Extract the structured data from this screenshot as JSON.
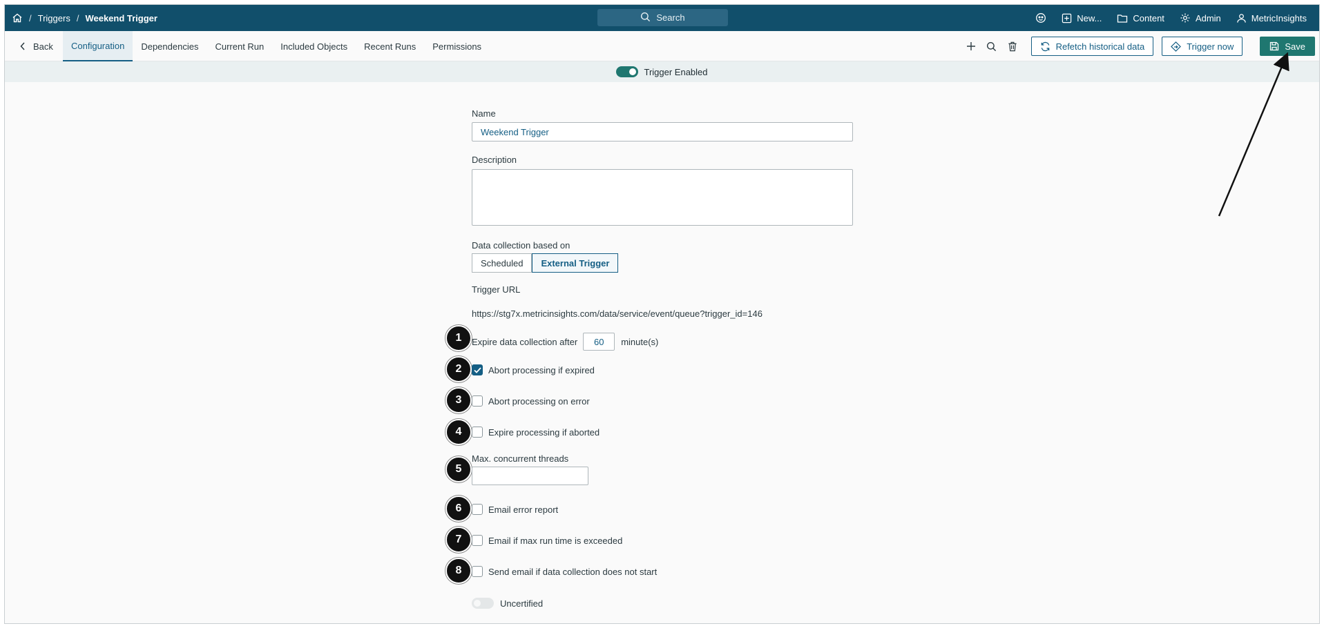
{
  "breadcrumb": {
    "home_icon": "home-icon",
    "separator": "/",
    "triggers": "Triggers",
    "current": "Weekend Trigger"
  },
  "search": {
    "label": "Search",
    "icon": "search-icon"
  },
  "topnav": {
    "new": "New...",
    "content": "Content",
    "admin": "Admin",
    "user": "MetricInsights"
  },
  "tabbar": {
    "back": "Back",
    "tabs": [
      "Configuration",
      "Dependencies",
      "Current Run",
      "Included Objects",
      "Recent Runs",
      "Permissions"
    ],
    "active_tab": "Configuration",
    "refetch": "Refetch historical data",
    "trigger_now": "Trigger now",
    "save": "Save"
  },
  "status": {
    "enabled": true,
    "label": "Trigger Enabled"
  },
  "form": {
    "name_label": "Name",
    "name_value": "Weekend Trigger",
    "description_label": "Description",
    "description_value": "",
    "collection_label": "Data collection based on",
    "collection_options": [
      "Scheduled",
      "External Trigger"
    ],
    "collection_selected": "External Trigger",
    "url_label": "Trigger URL",
    "url_value": "https://stg7x.metricinsights.com/data/service/event/queue?trigger_id=146",
    "expire_prefix": "Expire data collection after",
    "expire_value": "60",
    "expire_suffix": "minute(s)",
    "abort_expired": "Abort processing if expired",
    "abort_expired_checked": true,
    "abort_error": "Abort processing on error",
    "abort_error_checked": false,
    "expire_aborted": "Expire processing if aborted",
    "expire_aborted_checked": false,
    "threads_label": "Max. concurrent threads",
    "threads_value": "",
    "email_error": "Email error report",
    "email_error_checked": false,
    "email_runtime": "Email if max run time is exceeded",
    "email_runtime_checked": false,
    "email_nostart": "Send email if data collection does not start",
    "email_nostart_checked": false,
    "certified_label": "Uncertified",
    "certified": false
  },
  "markers": [
    "1",
    "2",
    "3",
    "4",
    "5",
    "6",
    "7",
    "8"
  ],
  "colors": {
    "topbar": "#114f6b",
    "accent": "#145e84",
    "save": "#1f7770",
    "strip": "#eaf0f1"
  }
}
